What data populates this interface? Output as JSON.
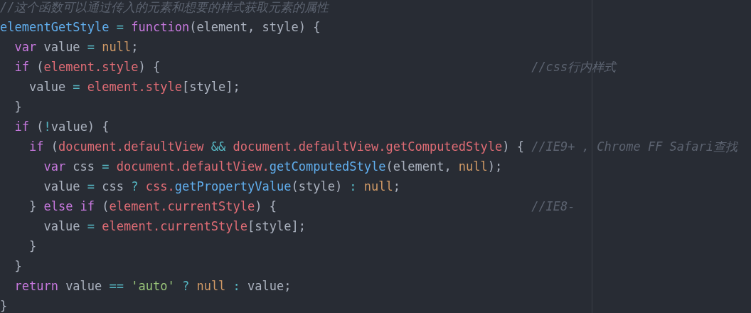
{
  "editor": {
    "lines": [
      {
        "tokens": [
          {
            "kind": "comment",
            "text": "//这个函数可以通过传入的元素和想要的样式获取元素的属性"
          }
        ]
      },
      {
        "tokens": [
          {
            "kind": "func",
            "text": "elementGetStyle"
          },
          {
            "kind": "op",
            "text": " = "
          },
          {
            "kind": "keyword",
            "text": "function"
          },
          {
            "kind": "plain",
            "text": "(element, style) {"
          }
        ]
      },
      {
        "tokens": [
          {
            "kind": "keyword",
            "text": "  var"
          },
          {
            "kind": "plain",
            "text": " value "
          },
          {
            "kind": "op",
            "text": "="
          },
          {
            "kind": "const",
            "text": " null"
          },
          {
            "kind": "plain",
            "text": ";"
          }
        ]
      },
      {
        "tokens": [
          {
            "kind": "keyword",
            "text": "  if"
          },
          {
            "kind": "plain",
            "text": " ("
          },
          {
            "kind": "var",
            "text": "element.style"
          },
          {
            "kind": "plain",
            "text": ") {"
          },
          {
            "kind": "aside",
            "text": "//css行内样式"
          }
        ]
      },
      {
        "tokens": [
          {
            "kind": "plain",
            "text": "    value "
          },
          {
            "kind": "op",
            "text": "="
          },
          {
            "kind": "var",
            "text": " element.style"
          },
          {
            "kind": "plain",
            "text": "[style];"
          }
        ]
      },
      {
        "tokens": [
          {
            "kind": "plain",
            "text": "  }"
          }
        ]
      },
      {
        "tokens": [
          {
            "kind": "keyword",
            "text": "  if"
          },
          {
            "kind": "plain",
            "text": " ("
          },
          {
            "kind": "op",
            "text": "!"
          },
          {
            "kind": "plain",
            "text": "value) {"
          }
        ]
      },
      {
        "tokens": [
          {
            "kind": "keyword",
            "text": "    if"
          },
          {
            "kind": "plain",
            "text": " ("
          },
          {
            "kind": "var",
            "text": "document.defaultView"
          },
          {
            "kind": "op",
            "text": " && "
          },
          {
            "kind": "var",
            "text": "document.defaultView.getComputedStyle"
          },
          {
            "kind": "plain",
            "text": ") {"
          },
          {
            "kind": "aside",
            "text": "//IE9+ , Chrome FF Safari查找"
          }
        ]
      },
      {
        "tokens": [
          {
            "kind": "keyword",
            "text": "      var"
          },
          {
            "kind": "plain",
            "text": " css "
          },
          {
            "kind": "op",
            "text": "="
          },
          {
            "kind": "var",
            "text": " document.defaultView."
          },
          {
            "kind": "func",
            "text": "getComputedStyle"
          },
          {
            "kind": "plain",
            "text": "(element, "
          },
          {
            "kind": "const",
            "text": "null"
          },
          {
            "kind": "plain",
            "text": ");"
          }
        ]
      },
      {
        "tokens": [
          {
            "kind": "plain",
            "text": "      value "
          },
          {
            "kind": "op",
            "text": "="
          },
          {
            "kind": "plain",
            "text": " css "
          },
          {
            "kind": "op",
            "text": "?"
          },
          {
            "kind": "var",
            "text": " css."
          },
          {
            "kind": "func",
            "text": "getPropertyValue"
          },
          {
            "kind": "plain",
            "text": "(style) "
          },
          {
            "kind": "op",
            "text": ":"
          },
          {
            "kind": "const",
            "text": " null"
          },
          {
            "kind": "plain",
            "text": ";"
          }
        ]
      },
      {
        "tokens": [
          {
            "kind": "plain",
            "text": "    } "
          },
          {
            "kind": "keyword",
            "text": "else if"
          },
          {
            "kind": "plain",
            "text": " ("
          },
          {
            "kind": "var",
            "text": "element.currentStyle"
          },
          {
            "kind": "plain",
            "text": ") {"
          },
          {
            "kind": "aside",
            "text": "//IE8-"
          }
        ]
      },
      {
        "tokens": [
          {
            "kind": "plain",
            "text": "      value "
          },
          {
            "kind": "op",
            "text": "="
          },
          {
            "kind": "var",
            "text": " element.currentStyle"
          },
          {
            "kind": "plain",
            "text": "[style];"
          }
        ]
      },
      {
        "tokens": [
          {
            "kind": "plain",
            "text": "    }"
          }
        ]
      },
      {
        "tokens": [
          {
            "kind": "plain",
            "text": "  }"
          }
        ]
      },
      {
        "tokens": [
          {
            "kind": "keyword",
            "text": "  return"
          },
          {
            "kind": "plain",
            "text": " value "
          },
          {
            "kind": "op",
            "text": "=="
          },
          {
            "kind": "string",
            "text": " 'auto'"
          },
          {
            "kind": "op",
            "text": " ?"
          },
          {
            "kind": "const",
            "text": " null"
          },
          {
            "kind": "op",
            "text": " :"
          },
          {
            "kind": "plain",
            "text": " value;"
          }
        ]
      },
      {
        "tokens": [
          {
            "kind": "plain",
            "text": "}"
          }
        ]
      }
    ]
  }
}
